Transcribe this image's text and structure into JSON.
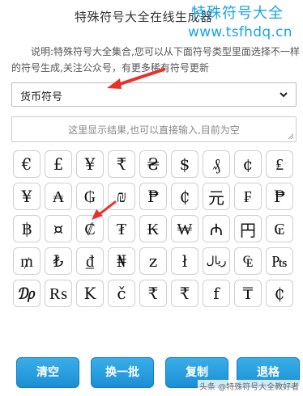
{
  "header": {
    "title": "特殊符号大全在线生成器",
    "watermark_cn": "特殊符号大全",
    "watermark_url": "www.tsfhdq.cn"
  },
  "description": "说明:特殊符号大全集合,您可以从下面符号类型里面选择不一样的符号生成,关注公众号，有更多稀有符号更新",
  "selector": {
    "selected": "货币符号"
  },
  "output": {
    "placeholder": "这里显示结果,也可以直接输入,目前为空"
  },
  "symbols": [
    "€",
    "£",
    "¥",
    "₹",
    "₴",
    "$",
    "₰",
    "¢",
    "₤",
    "¥",
    "₳",
    "₲",
    "₪",
    "₱",
    "₵",
    "元",
    "₣",
    "₱",
    "฿",
    "¤",
    "₡",
    "₮",
    "₭",
    "₩",
    "₼",
    "円",
    "₢",
    "₥",
    "₺",
    "₫",
    "₦",
    "z",
    "ł",
    "ریال",
    "₠",
    "₧",
    "₯",
    "₨",
    "K",
    "č",
    "₹",
    "₹",
    "f",
    "₸",
    "₵"
  ],
  "buttons": {
    "clear": "清空",
    "refresh": "换一批",
    "copy": "复制",
    "back": "退格"
  },
  "footer_watermark": "头条 @特殊符号大全教好者",
  "colors": {
    "accent": "#1b8fd3",
    "annotation_arrow": "#e8322b"
  }
}
